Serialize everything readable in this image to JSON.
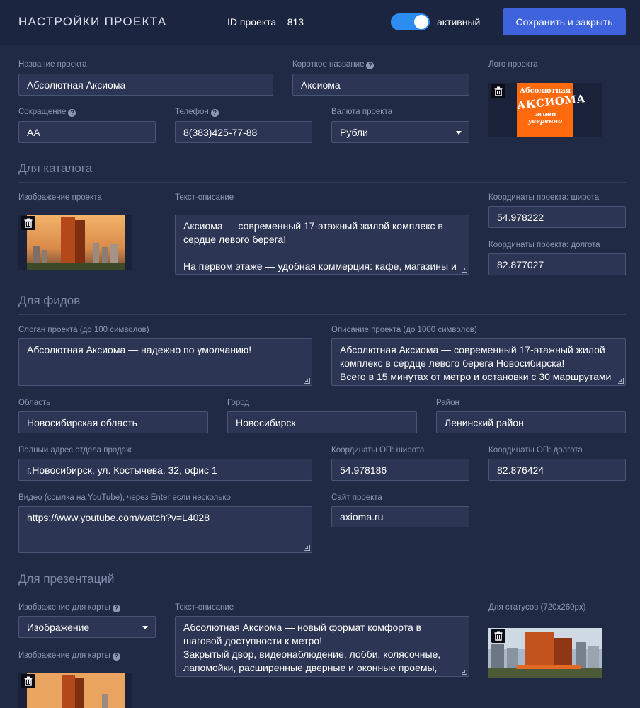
{
  "header": {
    "title": "НАСТРОЙКИ ПРОЕКТА",
    "project_id": "ID проекта – 813",
    "toggle_label": "активный",
    "save_label": "Сохранить и закрыть"
  },
  "general": {
    "name": {
      "label": "Название проекта",
      "value": "Абсолютная Аксиома"
    },
    "short_name": {
      "label": "Короткое название",
      "value": "Аксиома"
    },
    "logo": {
      "label": "Лого проекта",
      "text_line1": "Абсолютная",
      "text_line2": "АКСИОМА",
      "text_line3": "живи",
      "text_line4": "уверенно"
    },
    "abbr": {
      "label": "Сокращение",
      "value": "АА"
    },
    "phone": {
      "label": "Телефон",
      "value": "8(383)425-77-88"
    },
    "currency": {
      "label": "Валюта проекта",
      "value": "Рубли"
    }
  },
  "catalog": {
    "section_title": "Для каталога",
    "image_label": "Изображение проекта",
    "description": {
      "label": "Текст-описание",
      "value": "Аксиома — современный 17-этажный жилой комплекс в сердце левого берега!\n\nНа первом этаже — удобная коммерция: кафе, магазины и"
    },
    "lat": {
      "label": "Координаты проекта: широта",
      "value": "54.978222"
    },
    "lng": {
      "label": "Координаты проекта: долгота",
      "value": "82.877027"
    }
  },
  "feeds": {
    "section_title": "Для фидов",
    "slogan": {
      "label": "Слоган проекта (до 100 символов)",
      "value": "Абсолютная Аксиома — надежно по умолчанию!"
    },
    "description": {
      "label": "Описание проекта (до 1000 символов)",
      "value": "Абсолютная Аксиома — современный 17-этажный жилой комплекс в сердце левого берега Новосибирска!\nВсего в 15 минутах от метро и остановки с 30 маршрутами —"
    },
    "region": {
      "label": "Область",
      "value": "Новосибирская область"
    },
    "city": {
      "label": "Город",
      "value": "Новосибирск"
    },
    "district": {
      "label": "Район",
      "value": "Ленинский район"
    },
    "address": {
      "label": "Полный адрес отдела продаж",
      "value": "г.Новосибирск, ул. Костычева, 32, офис 1"
    },
    "op_lat": {
      "label": "Координаты ОП: широта",
      "value": "54.978186"
    },
    "op_lng": {
      "label": "Координаты ОП: долгота",
      "value": "82.876424"
    },
    "video": {
      "label": "Видео (ссылка на YouTube), через Enter если несколько",
      "value": "https://www.youtube.com/watch?v=L4028"
    },
    "site": {
      "label": "Сайт проекта",
      "value": "axioma.ru"
    }
  },
  "presentations": {
    "section_title": "Для презентаций",
    "map_image_select": {
      "label": "Изображение для карты",
      "value": "Изображение"
    },
    "map_image_label": "Изображение для карты",
    "description": {
      "label": "Текст-описание",
      "value": "Абсолютная Аксиома — новый формат комфорта в шаговой доступности к метро!\nЗакрытый двор, видеонаблюдение, лобби, колясочные, лапомойки, расширенные дверные и оконные проемы, теплый"
    },
    "status_label": "Для статусов (720x260px)"
  },
  "colors": {
    "accent": "#3e63dd",
    "toggle": "#2d8cf0",
    "background": "#212a45",
    "logo_orange": "#ff6a0f"
  }
}
